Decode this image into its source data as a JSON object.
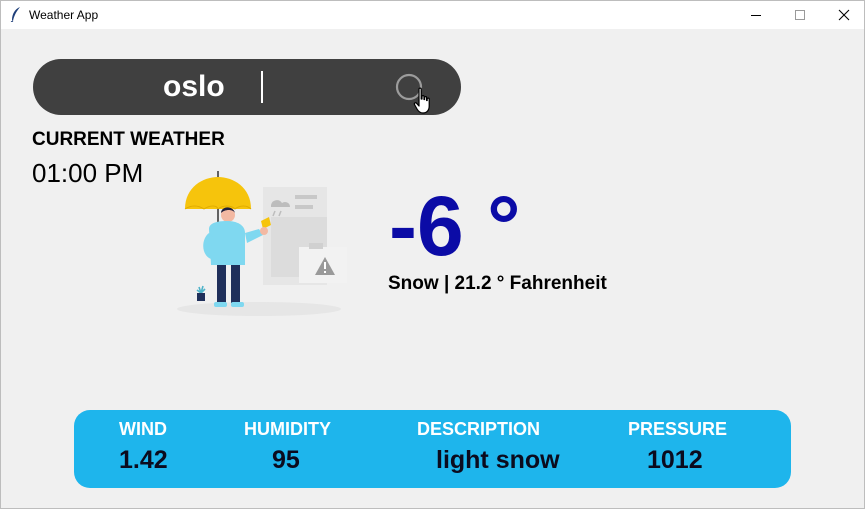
{
  "window": {
    "title": "Weather App",
    "icon": "feather-icon"
  },
  "search": {
    "value": "oslo",
    "icon": "search-icon"
  },
  "current": {
    "heading": "CURRENT WEATHER",
    "time": "01:00 PM"
  },
  "weather": {
    "temperature": "-6 °",
    "condition": "Snow | 21.2 ° Fahrenheit",
    "illustration": "person-with-umbrella-illustration"
  },
  "details": {
    "wind_label": "WIND",
    "wind_value": "1.42",
    "humidity_label": "HUMIDITY",
    "humidity_value": "95",
    "description_label": "DESCRIPTION",
    "description_value": "light snow",
    "pressure_label": "PRESSURE",
    "pressure_value": "1012"
  },
  "colors": {
    "background": "#f0f0f0",
    "search_bar": "#404040",
    "temperature": "#0b0ba6",
    "panel": "#1eb5ec"
  }
}
